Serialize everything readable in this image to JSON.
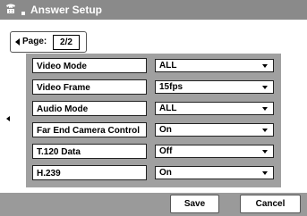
{
  "window": {
    "title": "Answer Setup",
    "icon": "phone-icon"
  },
  "pager": {
    "label": "Page:",
    "value": "2/2"
  },
  "settings": [
    {
      "label": "Video Mode",
      "value": "ALL"
    },
    {
      "label": "Video Frame",
      "value": "15fps"
    },
    {
      "label": "Audio Mode",
      "value": "ALL"
    },
    {
      "label": "Far End Camera Control",
      "value": "On"
    },
    {
      "label": "T.120 Data",
      "value": "Off"
    },
    {
      "label": "H.239",
      "value": "On"
    }
  ],
  "buttons": {
    "save": "Save",
    "cancel": "Cancel"
  },
  "colors": {
    "titlebar": "#8a8a8a",
    "panel": "#a0a0a0",
    "bottombar": "#9a9a9a"
  }
}
